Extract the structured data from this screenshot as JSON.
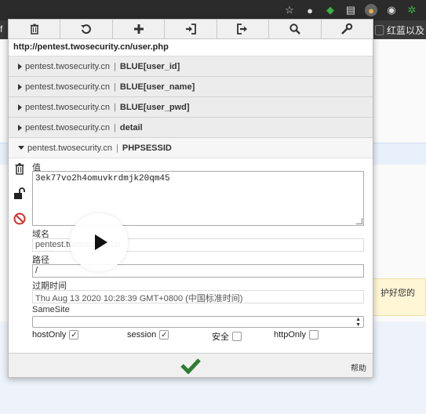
{
  "browser": {
    "bookmark_label": "红蓝以及"
  },
  "background": {
    "notice_text": "护好您的"
  },
  "toolbar": {
    "buttons": [
      "delete-all",
      "reset",
      "add",
      "import",
      "export",
      "search",
      "options"
    ]
  },
  "popup": {
    "url": "http://pentest.twosecurity.cn/user.php",
    "cookies": [
      {
        "domain": "pentest.twosecurity.cn",
        "separator": "|",
        "name": "BLUE[user_id]"
      },
      {
        "domain": "pentest.twosecurity.cn",
        "separator": "|",
        "name": "BLUE[user_name]"
      },
      {
        "domain": "pentest.twosecurity.cn",
        "separator": "|",
        "name": "BLUE[user_pwd]"
      },
      {
        "domain": "pentest.twosecurity.cn",
        "separator": "|",
        "name": "detail"
      },
      {
        "domain": "pentest.twosecurity.cn",
        "separator": "|",
        "name": "PHPSESSID"
      }
    ],
    "editor": {
      "value_label": "值",
      "value": "3ek77vo2h4omuvkrdmjk20qm45",
      "domain_label": "域名",
      "domain_value": "pentest.twosecurity.cn",
      "path_label": "路径",
      "path_value": "/",
      "expires_label": "过期时间",
      "expires_value": "Thu Aug 13 2020 10:28:39 GMT+0800 (中国标准时间)",
      "samesite_label": "SameSite",
      "samesite_value": "",
      "host_only_label": "hostOnly",
      "host_only_checked": true,
      "session_label": "session",
      "session_checked": true,
      "secure_label": "安全",
      "secure_checked": false,
      "http_only_label": "httpOnly",
      "http_only_checked": false
    },
    "footer": {
      "help_label": "帮助"
    }
  },
  "colors": {
    "ok_green": "#2e7d32",
    "block_red": "#d32f2f"
  }
}
